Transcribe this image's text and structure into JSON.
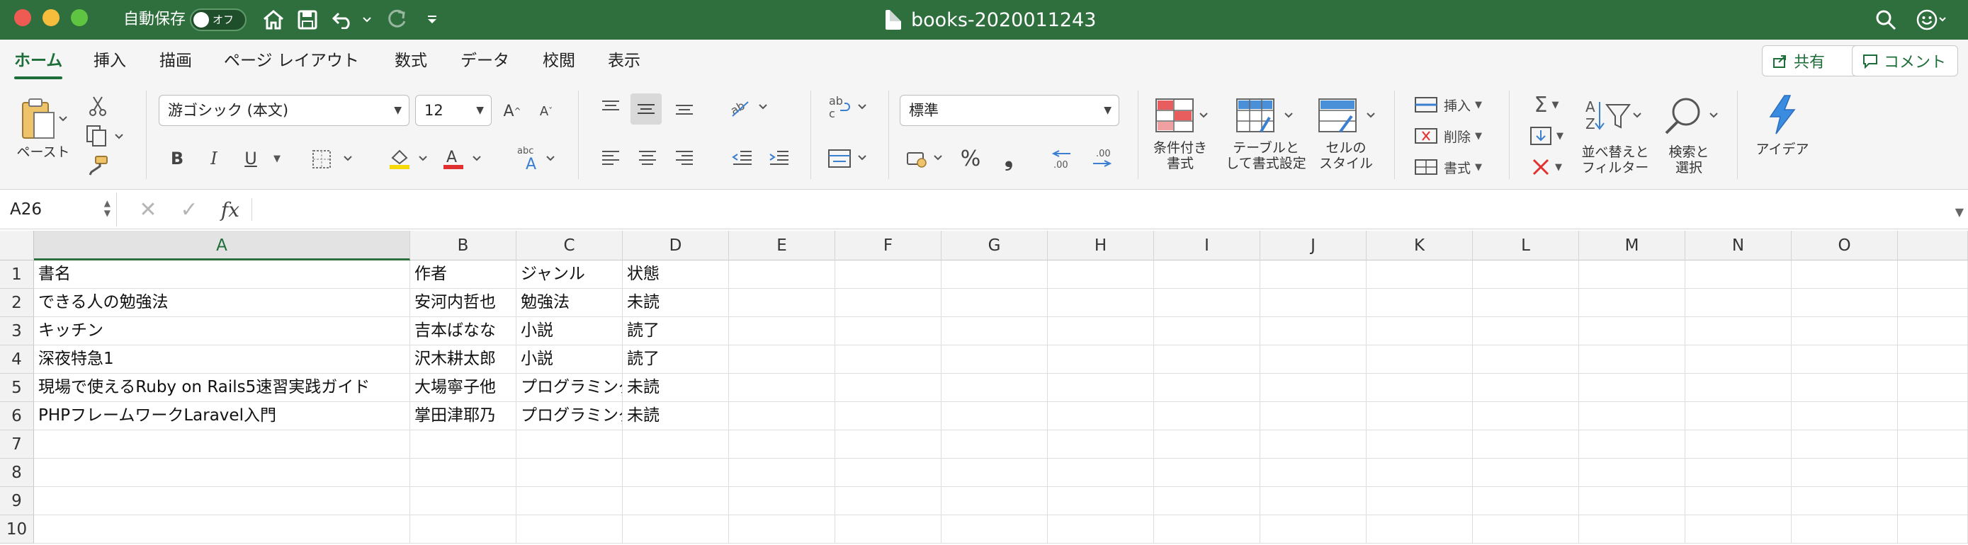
{
  "titlebar": {
    "autosave_label": "自動保存",
    "autosave_state": "オフ",
    "document_title": "books-2020011243"
  },
  "ribbon_tabs": [
    "ホーム",
    "挿入",
    "描画",
    "ページ レイアウト",
    "数式",
    "データ",
    "校閲",
    "表示"
  ],
  "share_label": "共有",
  "comment_label": "コメント",
  "ribbon": {
    "paste_label": "ペースト",
    "font_name": "游ゴシック (本文)",
    "font_size": "12",
    "number_format": "標準",
    "conditional_format_label": "条件付き\n書式",
    "table_format_label": "テーブルと\nして書式設定",
    "cell_style_label": "セルの\nスタイル",
    "insert_label": "挿入",
    "delete_label": "削除",
    "format_label": "書式",
    "sort_filter_label": "並べ替えと\nフィルター",
    "find_select_label": "検索と\n選択",
    "ideas_label": "アイデア",
    "bold": "B",
    "italic": "I",
    "underline": "U",
    "percent": "%",
    "comma": "❟",
    "fx": "fx"
  },
  "formula_bar": {
    "name_box": "A26",
    "formula": ""
  },
  "columns": [
    "A",
    "B",
    "C",
    "D",
    "E",
    "F",
    "G",
    "H",
    "I",
    "J",
    "K",
    "L",
    "M",
    "N",
    "O"
  ],
  "selected_column": "A",
  "rows": [
    {
      "num": "1",
      "cells": [
        "書名",
        "作者",
        "ジャンル",
        "状態"
      ]
    },
    {
      "num": "2",
      "cells": [
        "できる人の勉強法",
        "安河内哲也",
        "勉強法",
        "未読"
      ]
    },
    {
      "num": "3",
      "cells": [
        "キッチン",
        "吉本ばなな",
        "小説",
        "読了"
      ]
    },
    {
      "num": "4",
      "cells": [
        "深夜特急1",
        "沢木耕太郎",
        "小説",
        "読了"
      ]
    },
    {
      "num": "5",
      "cells": [
        "現場で使えるRuby on Rails5速習実践ガイド",
        "大場寧子他",
        "プログラミング",
        "未読"
      ]
    },
    {
      "num": "6",
      "cells": [
        "PHPフレームワークLaravel入門",
        "掌田津耶乃",
        "プログラミング",
        "未読"
      ]
    },
    {
      "num": "7",
      "cells": [
        "",
        "",
        "",
        ""
      ]
    },
    {
      "num": "8",
      "cells": [
        "",
        "",
        "",
        ""
      ]
    },
    {
      "num": "9",
      "cells": [
        "",
        "",
        "",
        ""
      ]
    },
    {
      "num": "10",
      "cells": [
        "",
        "",
        "",
        ""
      ]
    }
  ],
  "colors": {
    "titlebar": "#2f6f3e",
    "accent": "#1e6e3a",
    "fill_color": "#f5d90a",
    "font_color": "#e03030"
  }
}
